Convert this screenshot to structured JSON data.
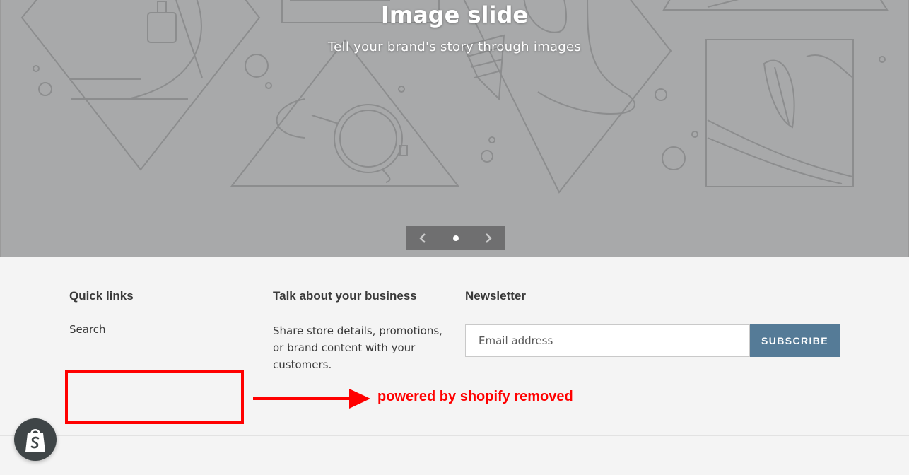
{
  "hero": {
    "title": "Image slide",
    "subtitle": "Tell your brand's story through images",
    "controls": {
      "prev_icon": "chevron-left-icon",
      "next_icon": "chevron-right-icon",
      "slide_count": 1,
      "active_slide": 1
    },
    "background_color": "#a8a9aa"
  },
  "footer": {
    "quick_links": {
      "heading": "Quick links",
      "items": [
        "Search"
      ]
    },
    "about": {
      "heading": "Talk about your business",
      "text": "Share store details, promotions, or brand content with your customers."
    },
    "newsletter": {
      "heading": "Newsletter",
      "email_placeholder": "Email address",
      "subscribe_label": "SUBSCRIBE"
    }
  },
  "annotation": {
    "text": "powered by shopify removed",
    "color": "#ff0000"
  },
  "badge": {
    "icon": "shopify-bag-icon"
  },
  "colors": {
    "accent": "#557b97",
    "footer_bg": "#f4f4f4",
    "text": "#3a3a3a"
  }
}
